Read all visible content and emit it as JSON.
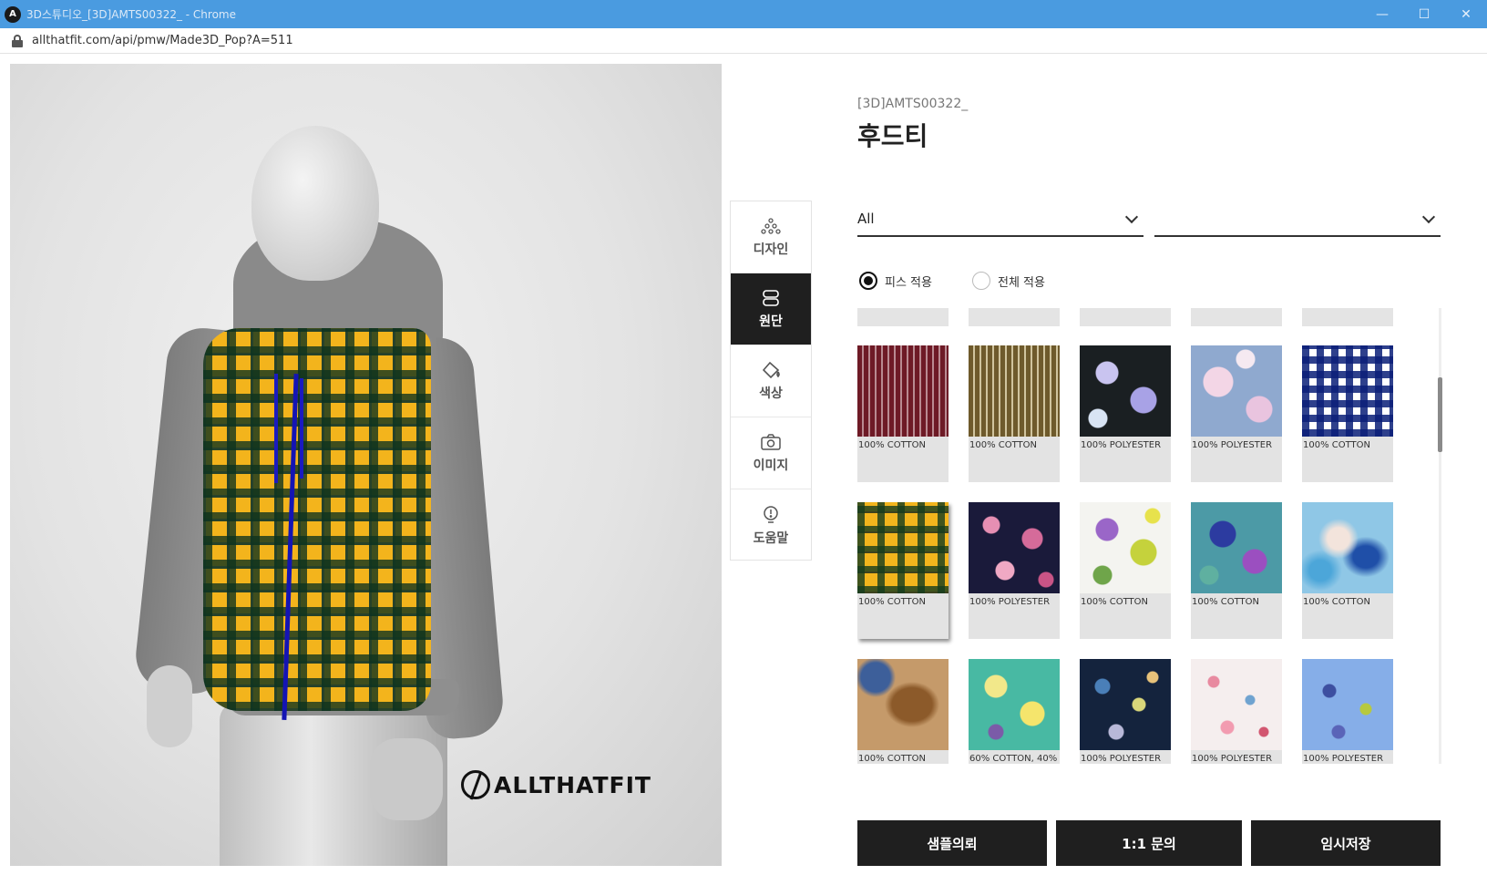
{
  "window": {
    "title": "3D스튜디오_[3D]AMTS00322_ - Chrome",
    "url": "allthatfit.com/api/pmw/Made3D_Pop?A=511",
    "app_icon_label": "A",
    "minimize": "—",
    "maximize": "☐",
    "close": "✕"
  },
  "viewer": {
    "brand": "ALLTHATFIT"
  },
  "tools": [
    {
      "label": "디자인",
      "icon": "design-dots-icon",
      "active": false
    },
    {
      "label": "원단",
      "icon": "fabric-roll-icon",
      "active": true
    },
    {
      "label": "색상",
      "icon": "paint-bucket-icon",
      "active": false
    },
    {
      "label": "이미지",
      "icon": "camera-icon",
      "active": false
    },
    {
      "label": "도움말",
      "icon": "lightbulb-icon",
      "active": false
    }
  ],
  "product": {
    "code": "[3D]AMTS00322_",
    "name": "후드티"
  },
  "filters": {
    "category": "All",
    "subcategory": ""
  },
  "apply_mode": {
    "piece": "피스 적용",
    "all": "전체 적용",
    "selected": "piece"
  },
  "fabrics": [
    {
      "name": "100% COTTON",
      "pattern": "stripe-red"
    },
    {
      "name": "100% COTTON",
      "pattern": "stripe-khaki"
    },
    {
      "name": "100% POLYESTER",
      "pattern": "floral-dark"
    },
    {
      "name": "100% POLYESTER",
      "pattern": "floral-blue"
    },
    {
      "name": "100% COTTON",
      "pattern": "gingham-navy"
    },
    {
      "name": "100% COTTON",
      "pattern": "tartan-yellow",
      "selected": true
    },
    {
      "name": "100% POLYESTER",
      "pattern": "floral-navy-pink"
    },
    {
      "name": "100% COTTON",
      "pattern": "floral-white"
    },
    {
      "name": "100% COTTON",
      "pattern": "floral-teal"
    },
    {
      "name": "100% COTTON",
      "pattern": "tiedye-blue"
    },
    {
      "name": "100% COTTON",
      "pattern": "brown-abstract"
    },
    {
      "name": "60% COTTON, 40%",
      "pattern": "floral-mint"
    },
    {
      "name": "100% POLYESTER",
      "pattern": "floral-navy-small"
    },
    {
      "name": "100% POLYESTER",
      "pattern": "floral-pink-white"
    },
    {
      "name": "100% POLYESTER",
      "pattern": "floral-sky-blue"
    }
  ],
  "scroll": {
    "position": 0.18
  },
  "actions": {
    "sample": "샘플의뢰",
    "inquiry": "1:1 문의",
    "save": "임시저장"
  }
}
